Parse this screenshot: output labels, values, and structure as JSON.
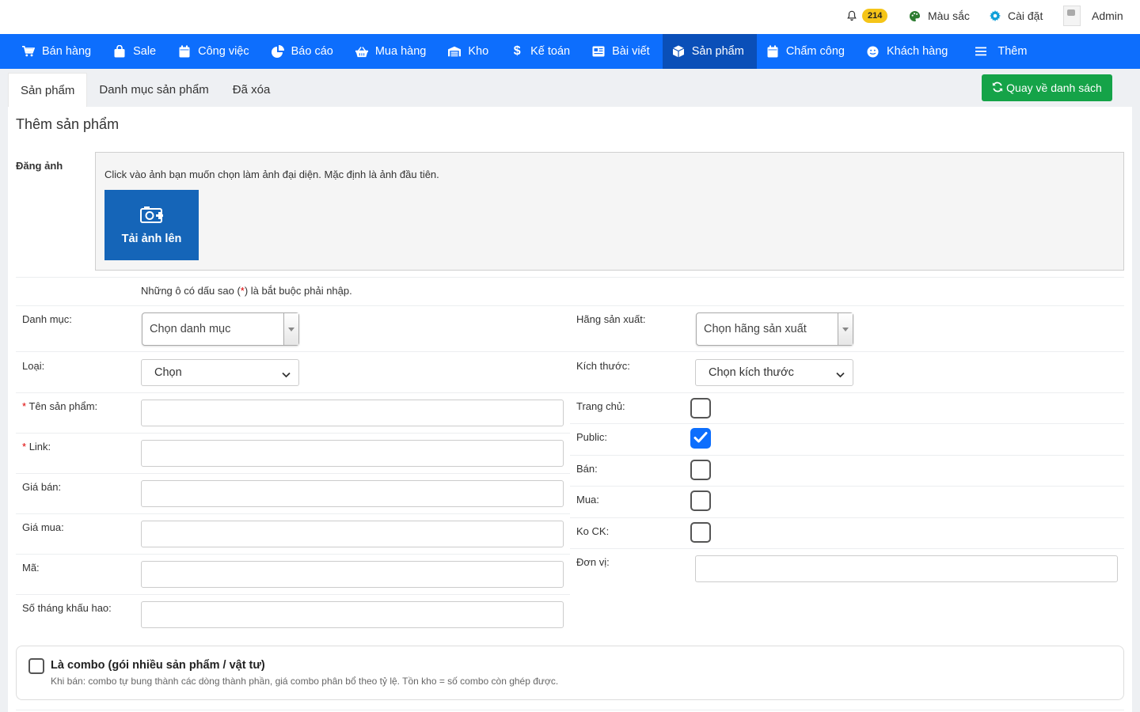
{
  "topbar": {
    "notifications_count": "214",
    "color_label": "Màu sắc",
    "settings_label": "Cài đặt",
    "user_name": "Admin"
  },
  "nav": [
    {
      "label": "Bán hàng",
      "icon": "cart-icon"
    },
    {
      "label": "Sale",
      "icon": "bag-icon"
    },
    {
      "label": "Công việc",
      "icon": "calendar-icon"
    },
    {
      "label": "Báo cáo",
      "icon": "pie-chart-icon"
    },
    {
      "label": "Mua hàng",
      "icon": "basket-icon"
    },
    {
      "label": "Kho",
      "icon": "warehouse-icon"
    },
    {
      "label": "Kế toán",
      "icon": "dollar-icon"
    },
    {
      "label": "Bài viết",
      "icon": "newspaper-icon"
    },
    {
      "label": "Sản phẩm",
      "icon": "box-icon",
      "active": true
    },
    {
      "label": "Chấm công",
      "icon": "calendar-icon"
    },
    {
      "label": "Khách hàng",
      "icon": "smile-icon"
    },
    {
      "label": "Thêm",
      "icon": "menu-icon"
    }
  ],
  "tabs": [
    {
      "label": "Sản phẩm",
      "active": true
    },
    {
      "label": "Danh mục sản phẩm"
    },
    {
      "label": "Đã xóa"
    }
  ],
  "back_button": "Quay về danh sách",
  "page_title": "Thêm sản phẩm",
  "upload": {
    "label": "Đăng ảnh",
    "hint": "Click vào ảnh bạn muốn chọn làm ảnh đại diện. Mặc định là ảnh đầu tiên.",
    "button": "Tải ảnh lên"
  },
  "required_note": {
    "before": "Những ô có dấu sao (",
    "star": "*",
    "after": ") là bắt buộc phải nhập."
  },
  "form_left": {
    "category_label": "Danh mục:",
    "category_placeholder": "Chọn danh mục",
    "type_label": "Loại:",
    "type_selected": "Chọn",
    "name_label": "Tên sản phẩm:",
    "link_label": "Link:",
    "sale_price_label": "Giá bán:",
    "buy_price_label": "Giá mua:",
    "code_label": "Mã:",
    "depreciation_label": "Số tháng khấu hao:",
    "required_star": "*"
  },
  "form_right": {
    "manufacturer_label": "Hãng sản xuất:",
    "manufacturer_placeholder": "Chọn hãng sản xuất",
    "size_label": "Kích thước:",
    "size_selected": "Chọn kích thước",
    "home_label": "Trang chủ:",
    "public_label": "Public:",
    "sell_label": "Bán:",
    "buy_label": "Mua:",
    "no_discount_label": "Ko CK:",
    "unit_label": "Đơn vị:",
    "home_checked": false,
    "public_checked": true,
    "sell_checked": false,
    "buy_checked": false,
    "no_discount_checked": false
  },
  "combo": {
    "title": "Là combo (gói nhiều sản phẩm / vật tư)",
    "description": "Khi bán: combo tự bung thành các dòng thành phần, giá combo phân bổ theo tỷ lệ. Tồn kho = số combo còn ghép được."
  },
  "colors": {
    "nav_bg": "#0d6efd",
    "nav_active": "#0a4fb8",
    "success": "#15a348",
    "upload_btn": "#1565b8",
    "badge": "#f5c518"
  }
}
